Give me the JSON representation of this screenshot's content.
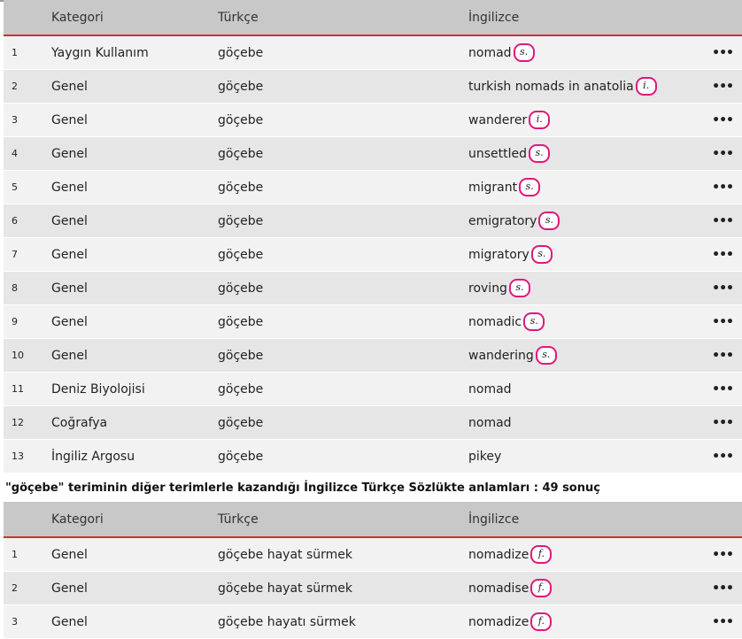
{
  "table1": {
    "headers": {
      "category": "Kategori",
      "turkish": "Türkçe",
      "english": "İngilizce"
    },
    "rows": [
      {
        "num": "1",
        "category": "Yaygın Kullanım",
        "turkish": "göçebe",
        "english": "nomad",
        "tag": "s."
      },
      {
        "num": "2",
        "category": "Genel",
        "turkish": "göçebe",
        "english": "turkish nomads in anatolia",
        "tag": "i."
      },
      {
        "num": "3",
        "category": "Genel",
        "turkish": "göçebe",
        "english": "wanderer",
        "tag": "i."
      },
      {
        "num": "4",
        "category": "Genel",
        "turkish": "göçebe",
        "english": "unsettled",
        "tag": "s."
      },
      {
        "num": "5",
        "category": "Genel",
        "turkish": "göçebe",
        "english": "migrant",
        "tag": "s."
      },
      {
        "num": "6",
        "category": "Genel",
        "turkish": "göçebe",
        "english": "emigratory",
        "tag": "s."
      },
      {
        "num": "7",
        "category": "Genel",
        "turkish": "göçebe",
        "english": "migratory",
        "tag": "s."
      },
      {
        "num": "8",
        "category": "Genel",
        "turkish": "göçebe",
        "english": "roving",
        "tag": "s."
      },
      {
        "num": "9",
        "category": "Genel",
        "turkish": "göçebe",
        "english": "nomadic",
        "tag": "s."
      },
      {
        "num": "10",
        "category": "Genel",
        "turkish": "göçebe",
        "english": "wandering",
        "tag": "s."
      },
      {
        "num": "11",
        "category": "Deniz Biyolojisi",
        "turkish": "göçebe",
        "english": "nomad",
        "tag": ""
      },
      {
        "num": "12",
        "category": "Coğrafya",
        "turkish": "göçebe",
        "english": "nomad",
        "tag": ""
      },
      {
        "num": "13",
        "category": "İngiliz Argosu",
        "turkish": "göçebe",
        "english": "pikey",
        "tag": ""
      }
    ]
  },
  "section_title": "\"göçebe\" teriminin diğer terimlerle kazandığı İngilizce Türkçe Sözlükte anlamları : 49 sonuç",
  "table2": {
    "headers": {
      "category": "Kategori",
      "turkish": "Türkçe",
      "english": "İngilizce"
    },
    "rows": [
      {
        "num": "1",
        "category": "Genel",
        "turkish": "göçebe hayat sürmek",
        "english": "nomadize",
        "tag": "f."
      },
      {
        "num": "2",
        "category": "Genel",
        "turkish": "göçebe hayat sürmek",
        "english": "nomadise",
        "tag": "f."
      },
      {
        "num": "3",
        "category": "Genel",
        "turkish": "göçebe hayatı sürmek",
        "english": "nomadize",
        "tag": "f."
      }
    ]
  },
  "menu_icon_glyph": "•••",
  "colors": {
    "header_bg": "#c8c8c8",
    "header_rule": "#c8342a",
    "tag_circle": "#e0187a"
  }
}
